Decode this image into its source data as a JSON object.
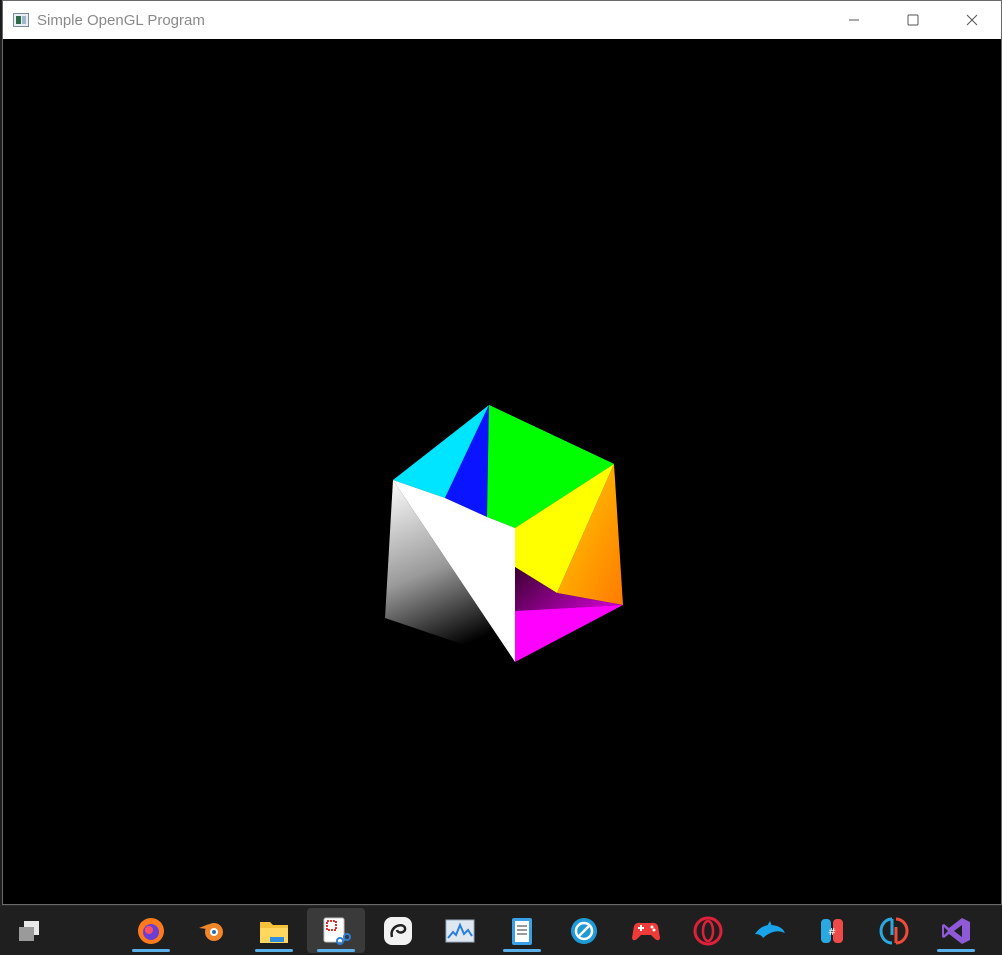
{
  "window": {
    "title": "Simple OpenGL Program",
    "icon": "app-window-icon",
    "controls": [
      "minimize-icon",
      "maximize-icon",
      "close-icon"
    ]
  },
  "scene": {
    "background": "#000000",
    "object": "rotating-colored-cube",
    "face_colors": [
      "#00ffff",
      "#0000ff",
      "#00ff00",
      "#ffff00",
      "#ff8c00",
      "#ff00ff",
      "#ffffff",
      "#800080"
    ]
  },
  "taskbar": {
    "background": "#1f1f1f",
    "items": [
      {
        "name": "task-view",
        "icon": "task-view-icon",
        "active": false,
        "running": false
      },
      {
        "name": "firefox",
        "icon": "firefox-icon",
        "active": false,
        "running": true
      },
      {
        "name": "blender",
        "icon": "blender-icon",
        "active": false,
        "running": false
      },
      {
        "name": "file-explorer",
        "icon": "folder-icon",
        "active": false,
        "running": true
      },
      {
        "name": "snipping-tool",
        "icon": "snipping-tool-icon",
        "active": true,
        "running": true
      },
      {
        "name": "clip-studio",
        "icon": "clip-studio-icon",
        "active": false,
        "running": false
      },
      {
        "name": "system-monitor",
        "icon": "monitor-graph-icon",
        "active": false,
        "running": false
      },
      {
        "name": "notepad",
        "icon": "notepad-icon",
        "active": false,
        "running": true
      },
      {
        "name": "browser",
        "icon": "globe-icon",
        "active": false,
        "running": false
      },
      {
        "name": "game-controller",
        "icon": "gamepad-icon",
        "active": false,
        "running": false
      },
      {
        "name": "opera",
        "icon": "opera-icon",
        "active": false,
        "running": false
      },
      {
        "name": "dolphin",
        "icon": "dolphin-icon",
        "active": false,
        "running": false
      },
      {
        "name": "app-sharp",
        "icon": "hash-app-icon",
        "active": false,
        "running": false
      },
      {
        "name": "yuzu",
        "icon": "yuzu-icon",
        "active": false,
        "running": false
      },
      {
        "name": "visual-studio",
        "icon": "visual-studio-icon",
        "active": false,
        "running": true
      }
    ]
  }
}
